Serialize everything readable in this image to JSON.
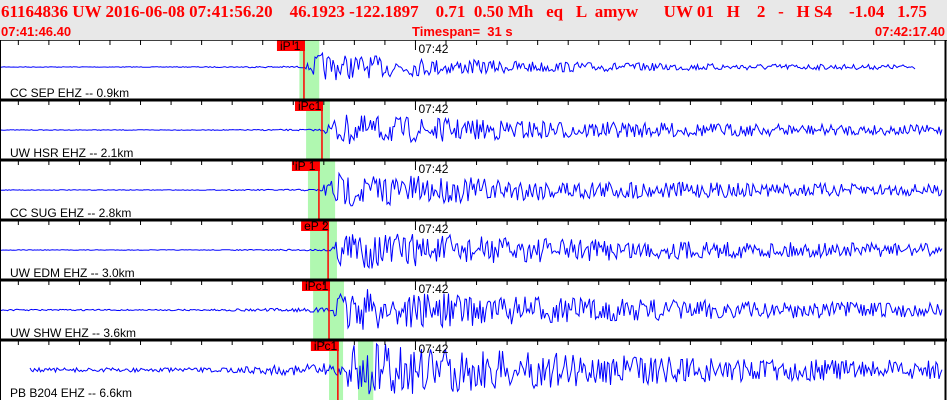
{
  "header": {
    "title": "61164836 UW 2016-06-08 07:41:56.20    46.1923 -122.1897    0.71  0.50 Mh   eq   L  amyw      UW 01   H    2   -   H S4    -1.04   1.75",
    "start_time": "07:41:46.40",
    "timespan": "Timespan=  31 s",
    "end_time": "07:42:17.40"
  },
  "minute_label": "07:42",
  "colors": {
    "trace": "#0000ff",
    "pick": "#ff0000",
    "window": "#b0f8b0",
    "header_text": "#ff0000",
    "header_bg": "#e8e8e8"
  },
  "channels": [
    {
      "label": "CC SEP EHZ -- 0.9km",
      "pick": "iP 1",
      "pick_time": "07:41:56.35",
      "windows": [
        [
          "07:41:56.20",
          "07:41:56.85"
        ]
      ]
    },
    {
      "label": "UW HSR EHZ -- 2.1km",
      "pick": "iPc1",
      "pick_time": "07:41:56.94",
      "windows": [
        [
          "07:41:56.42",
          "07:41:57.20"
        ]
      ]
    },
    {
      "label": "CC SUG EHZ -- 2.8km",
      "pick": "iP 1",
      "pick_time": "07:41:56.84",
      "windows": [
        [
          "07:41:56.48",
          "07:41:57.37"
        ]
      ]
    },
    {
      "label": "UW EDM EHZ -- 3.0km",
      "pick": "eP 2",
      "pick_time": "07:41:57.14",
      "windows": [
        [
          "07:41:56.55",
          "07:41:57.43"
        ]
      ]
    },
    {
      "label": "UW SHW EHZ -- 3.6km",
      "pick": "iPc1",
      "pick_time": "07:41:57.17",
      "windows": [
        [
          "07:41:56.65",
          "07:41:57.66"
        ]
      ]
    },
    {
      "label": "PB B204 EHZ -- 6.6km",
      "pick": "iPc1",
      "pick_time": "07:41:57.46",
      "windows": [
        [
          "07:41:57.17",
          "07:41:57.63"
        ],
        [
          "07:41:58.12",
          "07:41:58.62"
        ]
      ]
    }
  ]
}
